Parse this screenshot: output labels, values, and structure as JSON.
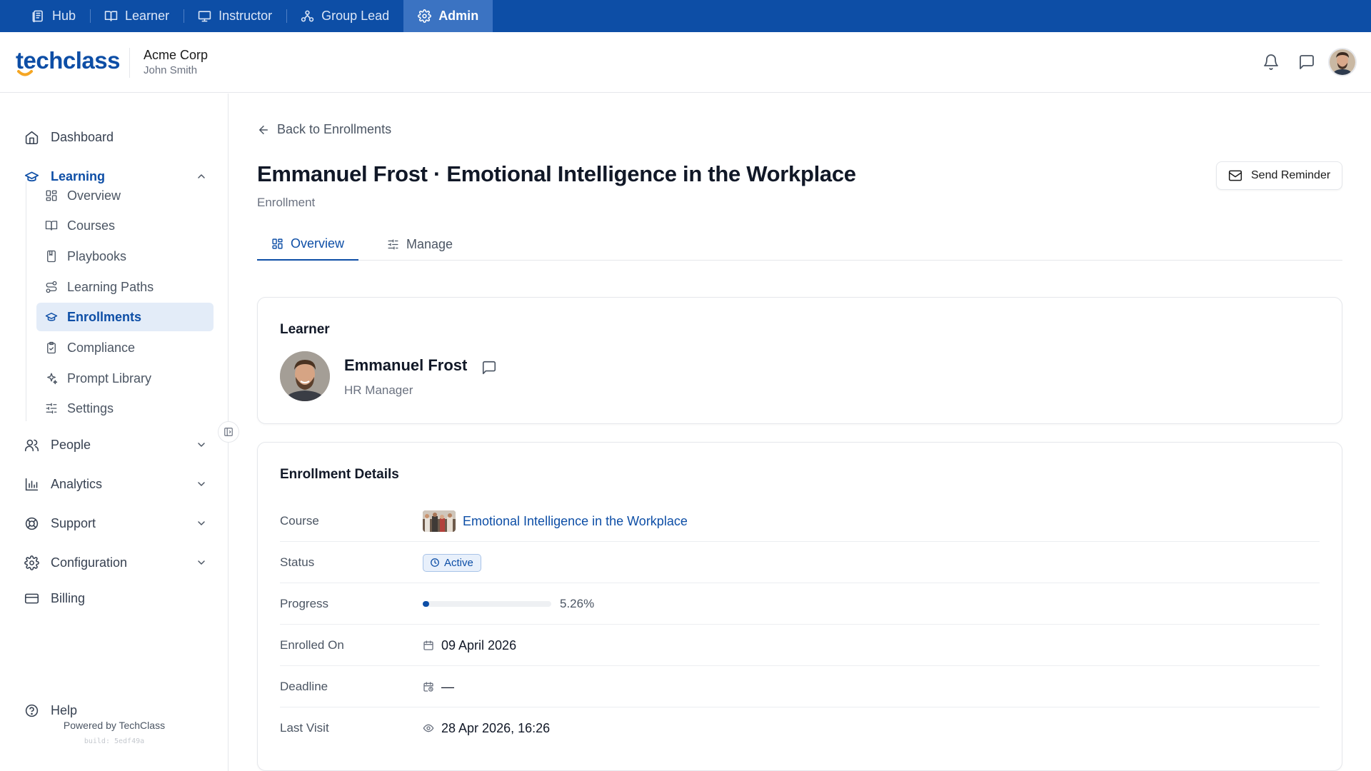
{
  "roles": [
    {
      "label": "Hub",
      "icon": "hub-icon",
      "active": false
    },
    {
      "label": "Learner",
      "icon": "book-open-icon",
      "active": false
    },
    {
      "label": "Instructor",
      "icon": "presentation-icon",
      "active": false
    },
    {
      "label": "Group Lead",
      "icon": "group-icon",
      "active": false
    },
    {
      "label": "Admin",
      "icon": "gear-icon",
      "active": true
    }
  ],
  "header": {
    "logo": "techclass",
    "org_name": "Acme Corp",
    "user_name": "John Smith"
  },
  "sidebar": {
    "items": [
      {
        "label": "Dashboard",
        "icon": "home-icon"
      },
      {
        "label": "Learning",
        "icon": "graduation-cap-icon",
        "expanded": true
      },
      {
        "label": "People",
        "icon": "users-icon"
      },
      {
        "label": "Analytics",
        "icon": "bar-chart-icon"
      },
      {
        "label": "Support",
        "icon": "lifebuoy-icon"
      },
      {
        "label": "Configuration",
        "icon": "gear-icon"
      },
      {
        "label": "Billing",
        "icon": "credit-card-icon"
      },
      {
        "label": "Help",
        "icon": "help-circle-icon"
      }
    ],
    "learning_sub": [
      {
        "label": "Overview",
        "icon": "grid-icon"
      },
      {
        "label": "Courses",
        "icon": "book-open-icon"
      },
      {
        "label": "Playbooks",
        "icon": "notebook-icon"
      },
      {
        "label": "Learning Paths",
        "icon": "route-icon"
      },
      {
        "label": "Enrollments",
        "icon": "graduation-cap-icon",
        "active": true
      },
      {
        "label": "Compliance",
        "icon": "clipboard-check-icon"
      },
      {
        "label": "Prompt Library",
        "icon": "sparkles-icon"
      },
      {
        "label": "Settings",
        "icon": "sliders-icon"
      }
    ],
    "powered_by": "Powered by TechClass",
    "build": "build: 5edf49a"
  },
  "page": {
    "back_label": "Back to Enrollments",
    "title": "Emmanuel Frost · Emotional Intelligence in the Workplace",
    "subtitle": "Enrollment",
    "send_reminder_label": "Send Reminder",
    "tabs": [
      {
        "label": "Overview",
        "icon": "grid-icon",
        "active": true
      },
      {
        "label": "Manage",
        "icon": "sliders-icon",
        "active": false
      }
    ]
  },
  "learner": {
    "section_title": "Learner",
    "name": "Emmanuel Frost",
    "role": "HR Manager"
  },
  "enrollment": {
    "section_title": "Enrollment Details",
    "course_label": "Course",
    "course_name": "Emotional Intelligence in the Workplace",
    "status_label": "Status",
    "status_value": "Active",
    "progress_label": "Progress",
    "progress_percent": 5.26,
    "progress_text": "5.26%",
    "enrolled_label": "Enrolled On",
    "enrolled_value": "09 April 2026",
    "deadline_label": "Deadline",
    "deadline_value": "—",
    "last_visit_label": "Last Visit",
    "last_visit_value": "28 Apr 2026, 16:26"
  },
  "colors": {
    "brand": "#0d4ea6",
    "accent_orange": "#f5a623",
    "active_nav_bg": "#e3ecf8"
  }
}
